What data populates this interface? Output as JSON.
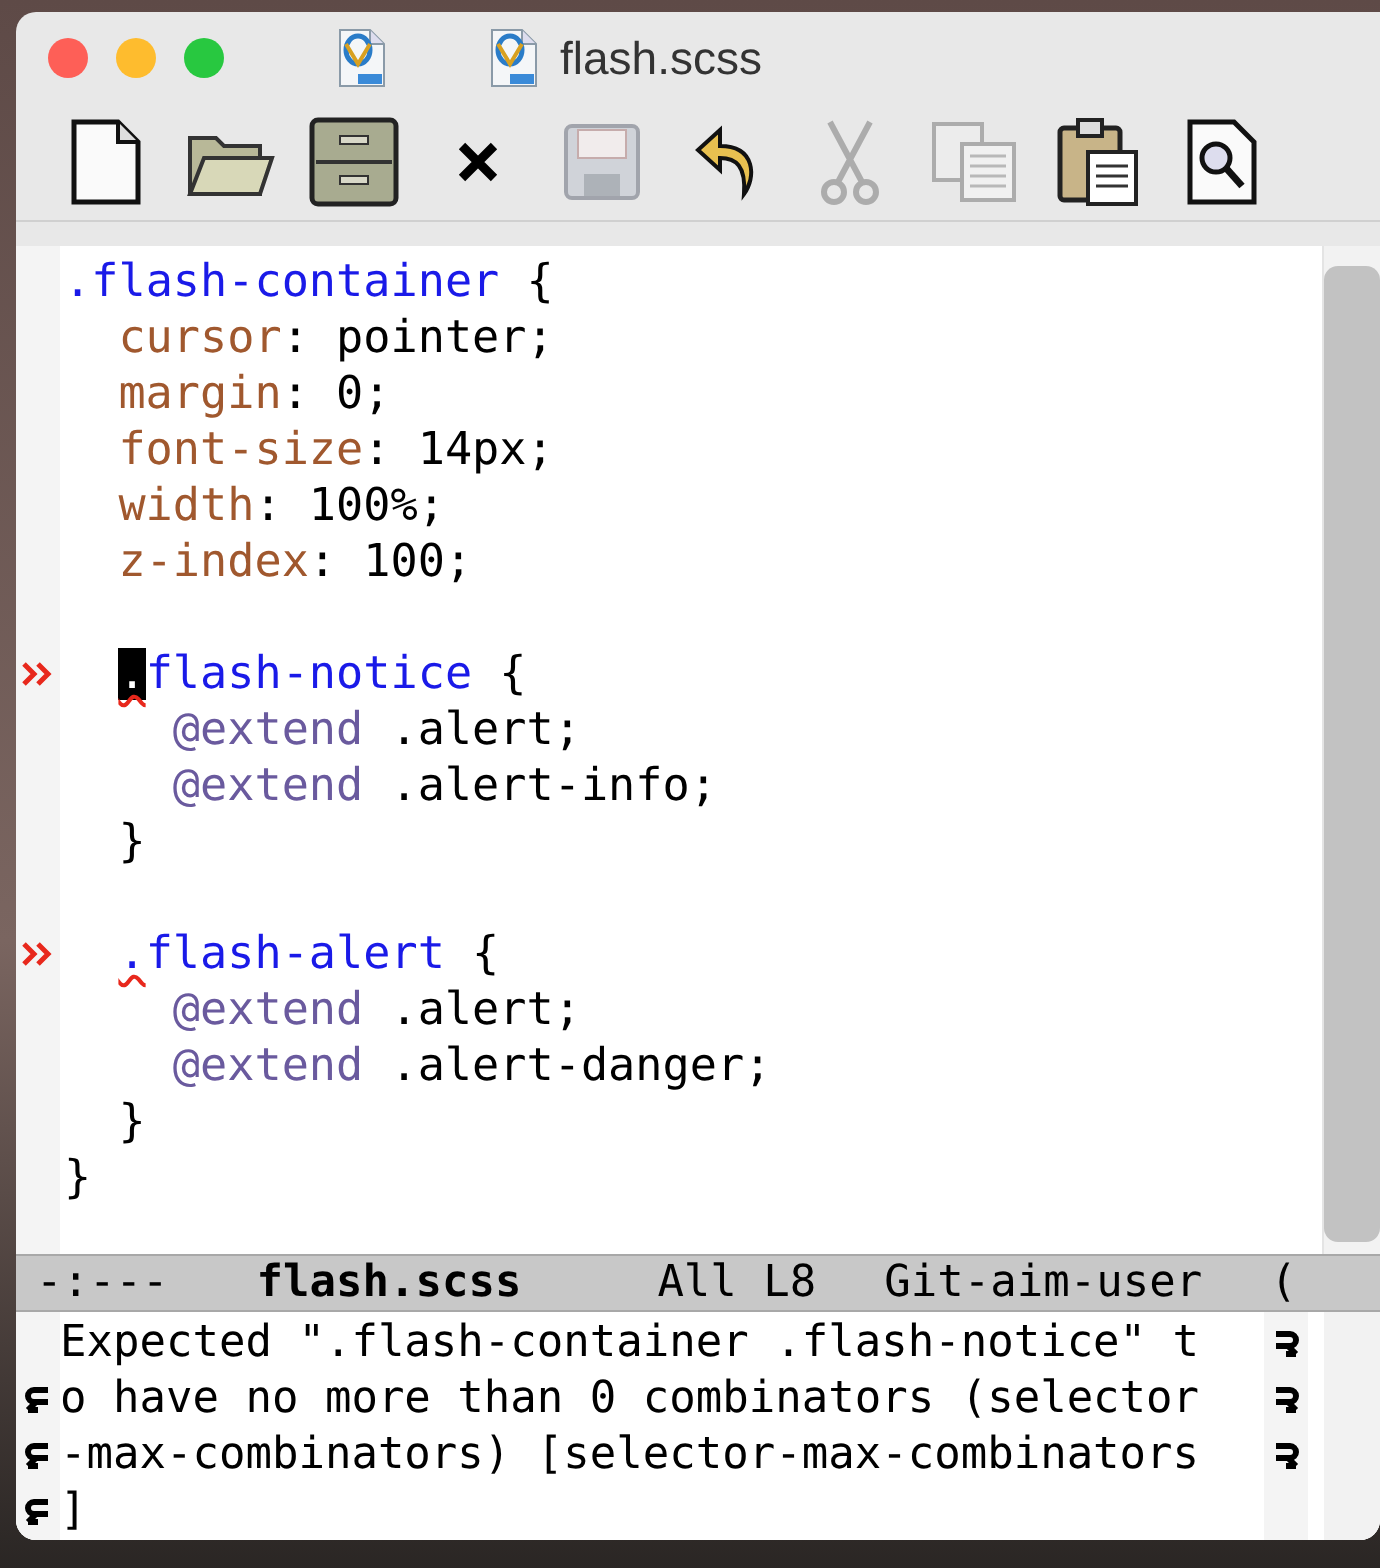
{
  "window": {
    "title": "flash.scss"
  },
  "toolbar": [
    {
      "kind": "new-file",
      "disabled": false
    },
    {
      "kind": "open-folder",
      "disabled": false
    },
    {
      "kind": "cabinet",
      "disabled": false
    },
    {
      "kind": "close",
      "disabled": false
    },
    {
      "kind": "save",
      "disabled": true
    },
    {
      "kind": "undo",
      "disabled": false
    },
    {
      "kind": "cut",
      "disabled": true
    },
    {
      "kind": "copy",
      "disabled": true
    },
    {
      "kind": "paste",
      "disabled": false
    },
    {
      "kind": "search",
      "disabled": false
    }
  ],
  "editor": {
    "rules": [
      {
        "flagged": false,
        "dot": ".",
        "name": "flash-container",
        "cursor": false,
        "error": false,
        "open": " {",
        "close": "}",
        "body": [
          {
            "kind": "declaration",
            "property": "cursor",
            "value": ": pointer;"
          },
          {
            "kind": "declaration",
            "property": "margin",
            "value": ": 0;"
          },
          {
            "kind": "declaration",
            "property": "font-size",
            "value": ": 14px;"
          },
          {
            "kind": "declaration",
            "property": "width",
            "value": ": 100%;"
          },
          {
            "kind": "declaration",
            "property": "z-index",
            "value": ": 100;"
          },
          {
            "kind": "blank"
          },
          {
            "kind": "rule",
            "flagged": true,
            "dot": ".",
            "name": "flash-notice",
            "cursor": true,
            "error": true,
            "open": " {",
            "close": "}",
            "body": [
              {
                "kind": "extend",
                "keyword": "@extend",
                "value": " .alert;"
              },
              {
                "kind": "extend",
                "keyword": "@extend",
                "value": " .alert-info;"
              }
            ]
          },
          {
            "kind": "blank"
          },
          {
            "kind": "rule",
            "flagged": true,
            "dot": ".",
            "name": "flash-alert",
            "cursor": false,
            "error": true,
            "open": " {",
            "close": "}",
            "body": [
              {
                "kind": "extend",
                "keyword": "@extend",
                "value": " .alert;"
              },
              {
                "kind": "extend",
                "keyword": "@extend",
                "value": " .alert-danger;"
              }
            ]
          }
        ]
      }
    ]
  },
  "mode_line": [
    {
      "text": "-:---",
      "bold": false
    },
    {
      "text": "flash.scss",
      "bold": true
    },
    {
      "text": "All L8",
      "bold": false
    },
    {
      "text": "Git-aim-user",
      "bold": false
    },
    {
      "text": "(",
      "bold": false
    }
  ],
  "echo_area": [
    {
      "text": "Expected \".flash-container .flash-notice\" t",
      "wrapped_from": false,
      "wraps_on": true
    },
    {
      "text": "o have no more than 0 combinators (selector",
      "wrapped_from": true,
      "wraps_on": true
    },
    {
      "text": "-max-combinators) [selector-max-combinators",
      "wrapped_from": true,
      "wraps_on": true
    },
    {
      "text": "]",
      "wrapped_from": true,
      "wraps_on": false
    }
  ]
}
